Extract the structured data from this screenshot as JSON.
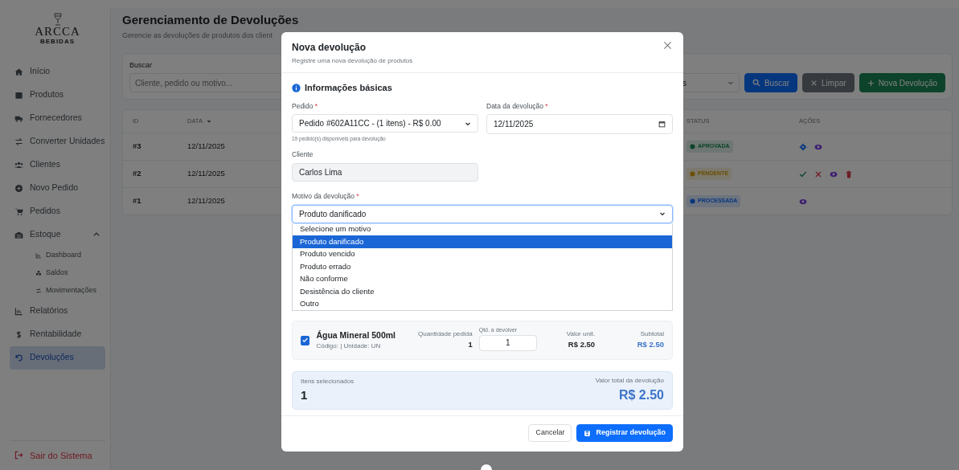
{
  "sidebar": {
    "logo": {
      "name": "ARCCA",
      "tagline": "BEBIDAS"
    },
    "items": [
      {
        "label": "Início",
        "selected": false
      },
      {
        "label": "Produtos",
        "selected": false
      },
      {
        "label": "Fornecedores",
        "selected": false
      },
      {
        "label": "Converter Unidades",
        "selected": false
      },
      {
        "label": "Clientes",
        "selected": false
      },
      {
        "label": "Novo Pedido",
        "selected": false
      },
      {
        "label": "Pedidos",
        "selected": false
      },
      {
        "label": "Estoque",
        "selected": false,
        "expanded": true,
        "children": [
          {
            "label": "Dashboard",
            "selected": false
          },
          {
            "label": "Saldos",
            "selected": false
          },
          {
            "label": "Movimentações",
            "selected": false
          }
        ]
      },
      {
        "label": "Relatórios",
        "selected": false
      },
      {
        "label": "Rentabilidade",
        "selected": false
      },
      {
        "label": "Devoluções",
        "selected": true
      }
    ],
    "logout": "Sair do Sistema"
  },
  "page": {
    "title": "Gerenciamento de Devoluções",
    "subtitle": "Gerencie as devoluções de produtos dos client"
  },
  "filters": {
    "search_label": "Buscar",
    "search_placeholder": "Cliente, pedido ou motivo...",
    "status_value": "s",
    "buttons": [
      {
        "label": "Buscar",
        "kind": "search"
      },
      {
        "label": "Limpar",
        "kind": "clear"
      },
      {
        "label": "Nova Devolução",
        "kind": "new"
      }
    ]
  },
  "table": {
    "columns": [
      {
        "label": "ID",
        "sorted": false
      },
      {
        "label": "DATA",
        "sorted": true
      },
      {
        "label": "STATUS",
        "sorted": false
      },
      {
        "label": "AÇÕES",
        "sorted": false
      }
    ],
    "rows": [
      {
        "id": "#3",
        "date": "12/11/2025",
        "status": "APROVADA",
        "kind": "approved",
        "actions": [
          {
            "kind": "process"
          },
          {
            "kind": "view"
          }
        ]
      },
      {
        "id": "#2",
        "date": "12/11/2025",
        "status": "PENDENTE",
        "kind": "pending",
        "actions": [
          {
            "kind": "approve"
          },
          {
            "kind": "reject"
          },
          {
            "kind": "view"
          },
          {
            "kind": "delete"
          }
        ]
      },
      {
        "id": "#1",
        "date": "12/11/2025",
        "status": "PROCESSADA",
        "kind": "processed",
        "actions": [
          {
            "kind": "view"
          }
        ]
      }
    ]
  },
  "modal": {
    "title": "Nova devolução",
    "subtitle": "Registre uma nova devolução de produtos",
    "section": "Informações básicas",
    "order": {
      "label": "Pedido",
      "required": "*",
      "value": "Pedido #602A11CC - (1 itens) - R$ 0.00",
      "hint": "19 pedido(s) disponíveis para devolução"
    },
    "date": {
      "label": "Data da devolução",
      "required": "*",
      "value": "12/11/2025"
    },
    "client": {
      "label": "Cliente",
      "value": "Carlos Lima"
    },
    "reason": {
      "label": "Motivo da devolução",
      "required": "*",
      "value": "Produto danificado",
      "options": [
        {
          "label": "Selecione um motivo",
          "selected": false
        },
        {
          "label": "Produto danificado",
          "selected": true
        },
        {
          "label": "Produto vencido",
          "selected": false
        },
        {
          "label": "Produto errado",
          "selected": false
        },
        {
          "label": "Não conforme",
          "selected": false
        },
        {
          "label": "Desistência do cliente",
          "selected": false
        },
        {
          "label": "Outro",
          "selected": false
        }
      ]
    },
    "items": [
      {
        "checked": true,
        "name": "Água Mineral 500ml",
        "meta": "Código: | Unidade: UN",
        "qty_label": "Quantidade pedida",
        "qty": "1",
        "return_label": "Qtd. a devolver",
        "return_qty": "1",
        "unit_label": "Valor unit.",
        "unit": "R$ 2.50",
        "subtotal_label": "Subtotal",
        "subtotal": "R$ 2.50"
      }
    ],
    "summary": {
      "count_label": "Itens selecionados",
      "count": "1",
      "total_label": "Valor total da devolução",
      "total": "R$ 2.50"
    },
    "buttons": [
      {
        "label": "Cancelar",
        "kind": "cancel"
      },
      {
        "label": "Registrar devolução",
        "kind": "submit"
      }
    ]
  }
}
